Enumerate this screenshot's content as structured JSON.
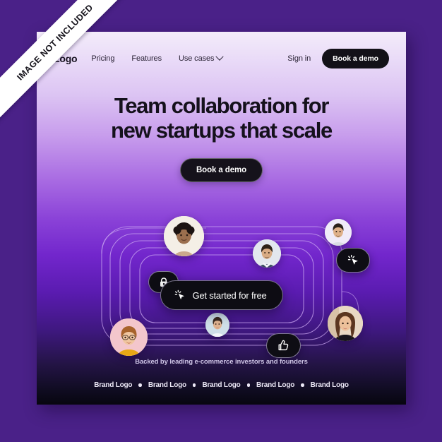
{
  "ribbon": {
    "label": "IMAGE NOT INCLUDED"
  },
  "colors": {
    "page_background": "#4a2188",
    "card_top": "#f3ecfa",
    "card_mid": "#7226cc",
    "card_bottom": "#07060f",
    "button_dark": "#131118",
    "orbit_line": "#c9a6f0",
    "footer_text": "#cfc6e6"
  },
  "nav": {
    "logo": "Logo",
    "links": [
      {
        "label": "Pricing",
        "icon": ""
      },
      {
        "label": "Features",
        "icon": ""
      },
      {
        "label": "Use cases",
        "icon": "chevron-down-icon"
      }
    ],
    "signin": "Sign in",
    "cta": "Book a demo"
  },
  "hero": {
    "headline_line1": "Team collaboration for",
    "headline_line2": "new startups that scale",
    "cta": "Book a demo"
  },
  "orbit": {
    "center_cta": {
      "label": "Get started for free",
      "icon": "cursor-click-icon"
    },
    "badges": [
      {
        "name": "lock-badge",
        "icon": "lock-icon"
      },
      {
        "name": "cursor-badge",
        "icon": "cursor-click-icon"
      },
      {
        "name": "thumbs-up-badge",
        "icon": "thumbs-up-icon"
      }
    ],
    "avatars": [
      {
        "name": "avatar-top-left",
        "background": "#f4efe6"
      },
      {
        "name": "avatar-top-center",
        "background": "#e3e7ee"
      },
      {
        "name": "avatar-top-right",
        "background": "#f0ebf8"
      },
      {
        "name": "avatar-bottom-left",
        "background": "#f3c6cc"
      },
      {
        "name": "avatar-bottom-center",
        "background": "#cfe0e8"
      },
      {
        "name": "avatar-bottom-right",
        "background": "#e8d8c4"
      }
    ]
  },
  "footer": {
    "backed_by": "Backed by leading e-commerce investors and founders",
    "brands": [
      "Brand Logo",
      "Brand Logo",
      "Brand Logo",
      "Brand Logo",
      "Brand Logo"
    ]
  }
}
